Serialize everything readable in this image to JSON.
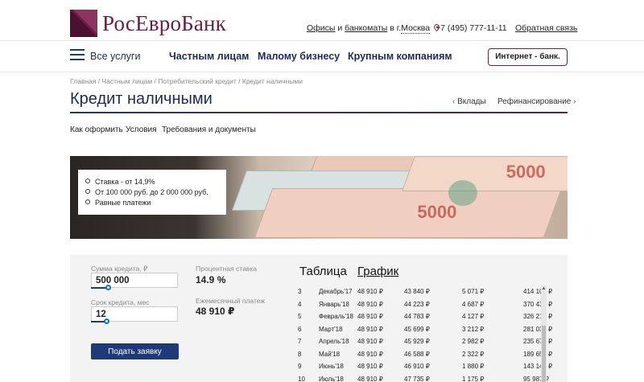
{
  "brand": {
    "name": "РосЕвроБанк",
    "color": "#6b1e44",
    "accent": "#1e3a78"
  },
  "top": {
    "offices": "Офисы",
    "and": " и ",
    "atms": "банкоматы",
    "in_city": " в г.",
    "city": "Москва",
    "phone": "+7 (495) 777-11-11",
    "feedback": "Обратная связь"
  },
  "nav": {
    "all_services": "Все услуги",
    "items": [
      "Частным лицам",
      "Малому бизнесу",
      "Крупным компаниям"
    ],
    "internet_bank": "Интернет - банк."
  },
  "breadcrumb": "Главная / Частным лицам / Потребительский кредит / Кредит наличными",
  "page": {
    "title": "Кредит наличными",
    "prev_link": "Вклады",
    "next_link": "Рефинансирование",
    "tabs": [
      "Как оформить",
      "Условия",
      "Требования и документы"
    ]
  },
  "banner": {
    "features": [
      "Ставка - от 14,9%",
      "От 100 000 руб. до 2 000 000 руб.",
      "Равные платежи"
    ]
  },
  "calculator": {
    "amount_label": "Сумма кредита, ₽",
    "amount_value": "500 000",
    "term_label": "Срок кредита, мес",
    "term_value": "12",
    "rate_label": "Процентная ставка",
    "rate_value": "14.9 %",
    "monthly_label": "Ежемесячный платеж",
    "monthly_value": "48 910 ₽",
    "submit": "Подать заявку",
    "view_table": "Таблица",
    "view_chart": "График",
    "rows": [
      [
        "3",
        "Декабрь'17",
        "48 910 ₽",
        "43 840 ₽",
        "5 071 ₽",
        "414 108 ₽"
      ],
      [
        "4",
        "Январь'18",
        "48 910 ₽",
        "44 223 ₽",
        "4 687 ₽",
        "370 438 ₽"
      ],
      [
        "5",
        "Февраль'18",
        "48 910 ₽",
        "44 783 ₽",
        "4 127 ₽",
        "326 215 ₽"
      ],
      [
        "6",
        "Март'18",
        "48 910 ₽",
        "45 699 ₽",
        "3 212 ₽",
        "281 033 ₽"
      ],
      [
        "7",
        "Апрель'18",
        "48 910 ₽",
        "45 929 ₽",
        "2 982 ₽",
        "235 679 ₽"
      ],
      [
        "8",
        "Май'18",
        "48 910 ₽",
        "46 588 ₽",
        "2 322 ₽",
        "189 655 ₽"
      ],
      [
        "9",
        "Июнь'18",
        "48 910 ₽",
        "46 910 ₽",
        "1 880 ₽",
        "143 144 ₽"
      ],
      [
        "10",
        "Июль'18",
        "48 910 ₽",
        "47 735 ₽",
        "1 175 ₽",
        "95 987 ₽"
      ]
    ]
  }
}
